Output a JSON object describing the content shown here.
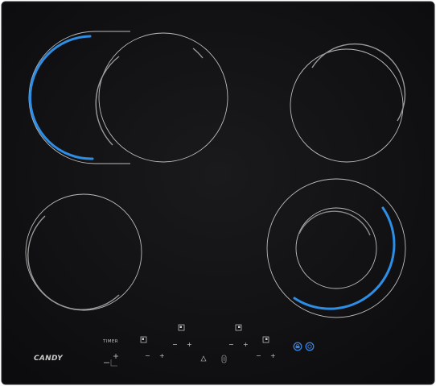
{
  "product": {
    "brand": "CANDY",
    "timer_label": "TIMER"
  },
  "controls": {
    "minus": "−",
    "plus": "+"
  },
  "colors": {
    "glass": "#111113",
    "glass_edge": "#2a2a2d",
    "zone_line": "#bcbcbc",
    "highlight": "#2d8ee6",
    "control_accent": "#3a7fd8",
    "control_text": "#c4c4c4"
  },
  "icons": {
    "zone_selectors": "square-dot-icon",
    "lock": "lock-icon",
    "power": "power-icon",
    "info": "info-icon",
    "heat_warning": "triangle-warning-icon"
  }
}
